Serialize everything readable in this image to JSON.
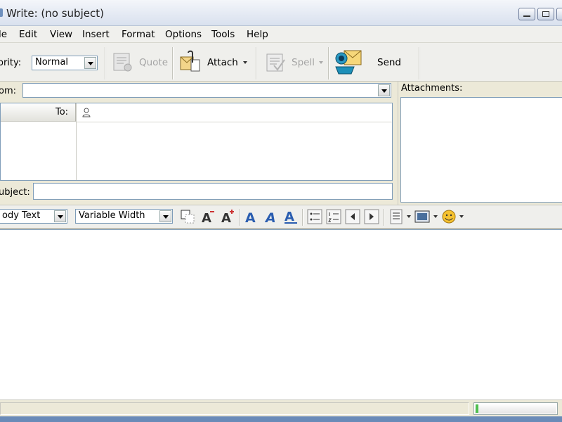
{
  "window": {
    "title": "Write: (no subject)"
  },
  "menu": [
    "le",
    "Edit",
    "View",
    "Insert",
    "Format",
    "Options",
    "Tools",
    "Help"
  ],
  "toolbar": {
    "priority_label": "ority:",
    "priority_value": "Normal",
    "quote": "Quote",
    "attach": "Attach",
    "spell": "Spell",
    "send": "Send"
  },
  "compose": {
    "from_label": "om:",
    "from_value": "",
    "to_label": "To:",
    "to_value": "",
    "subject_label": "ubject:",
    "subject_value": ""
  },
  "attachments": {
    "label": "Attachments:"
  },
  "format": {
    "paragraph_style": "ody Text",
    "font": "Variable Width"
  },
  "editor": {
    "body": ""
  },
  "status": {
    "text": "",
    "progress": 0.04
  },
  "colors": {
    "accent": "#2a5db0",
    "send_icon": "#1d8fb8",
    "progress_green": "#4fbf4f"
  }
}
